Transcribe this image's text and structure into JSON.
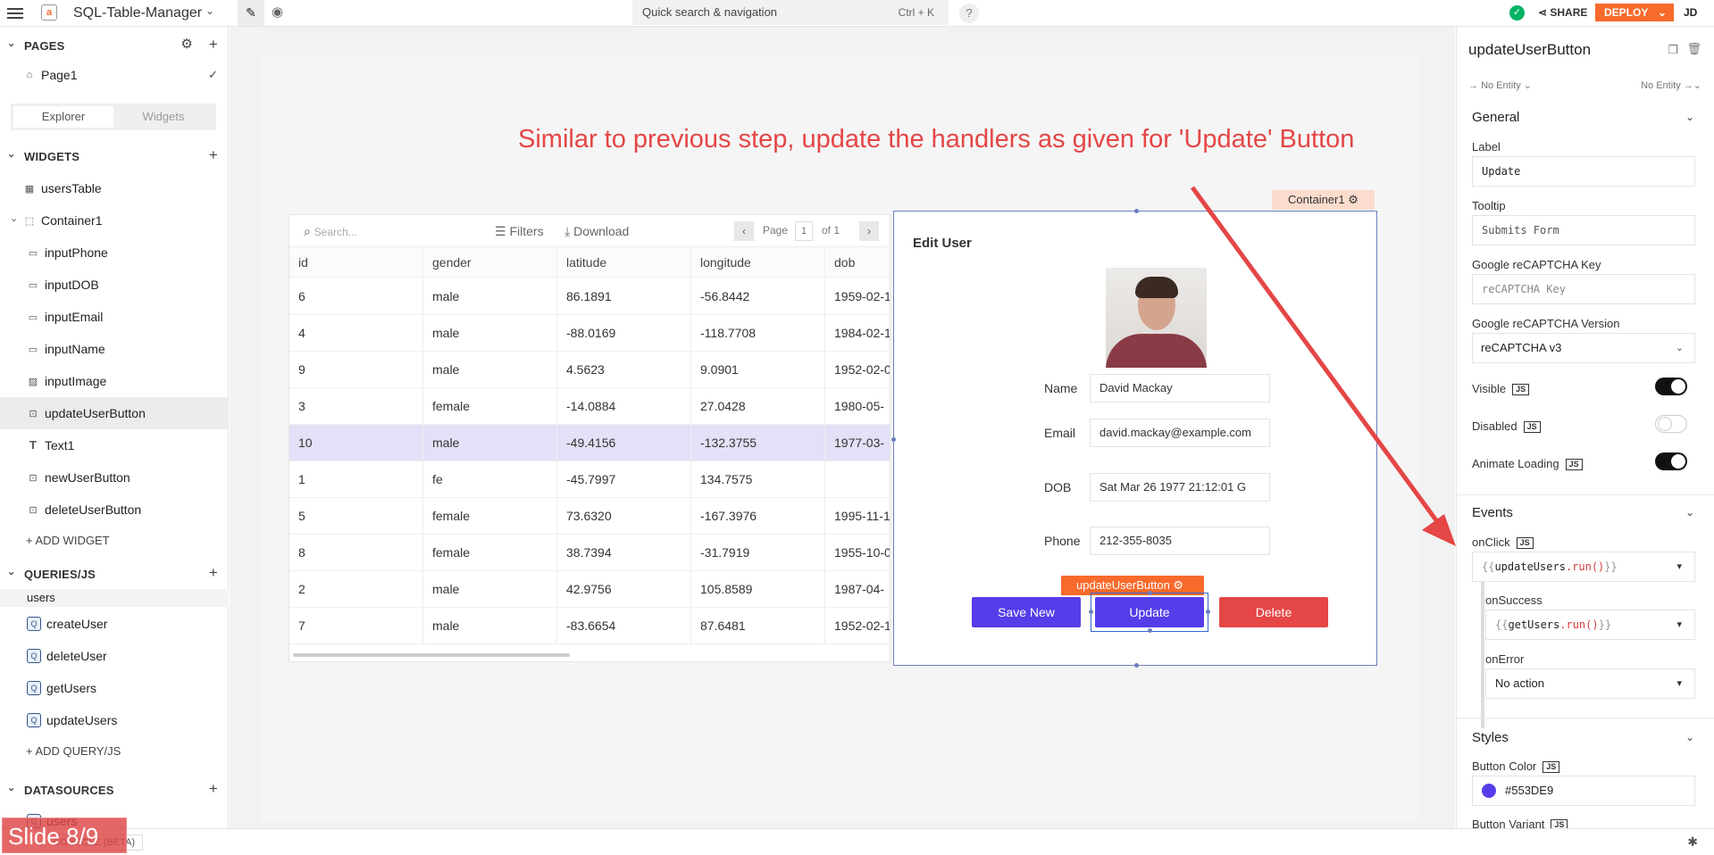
{
  "topbar": {
    "app_title": "SQL-Table-Manager",
    "search_label": "Quick search & navigation",
    "search_shortcut": "Ctrl + K",
    "help": "?",
    "share": "SHARE",
    "deploy": "DEPLOY",
    "user_initials": "JD"
  },
  "sidebar": {
    "pages_title": "PAGES",
    "page1": "Page1",
    "tab_explorer": "Explorer",
    "tab_widgets": "Widgets",
    "widgets_title": "WIDGETS",
    "widgets": [
      "usersTable",
      "Container1",
      "inputPhone",
      "inputDOB",
      "inputEmail",
      "inputName",
      "inputImage",
      "updateUserButton",
      "Text1",
      "newUserButton",
      "deleteUserButton"
    ],
    "add_widget": "ADD WIDGET",
    "queries_title": "QUERIES/JS",
    "users_group": "users",
    "queries": [
      "createUser",
      "deleteUser",
      "getUsers",
      "updateUsers"
    ],
    "add_query": "ADD QUERY/JS",
    "datasources_title": "DATASOURCES",
    "datasource": "users"
  },
  "bottom": {
    "console": "CONSOLE (BETA)",
    "slide": "Slide 8/9"
  },
  "annotation": "Similar to previous step, update the handlers as given for 'Update' Button",
  "table": {
    "search_placeholder": "Search...",
    "filters": "Filters",
    "download": "Download",
    "page_label": "Page",
    "page_num": "1",
    "page_of": "of 1",
    "columns": [
      "id",
      "gender",
      "latitude",
      "longitude",
      "dob"
    ],
    "rows": [
      [
        "6",
        "male",
        "86.1891",
        "-56.8442",
        "1959-02-1"
      ],
      [
        "4",
        "male",
        "-88.0169",
        "-118.7708",
        "1984-02-1"
      ],
      [
        "9",
        "male",
        "4.5623",
        "9.0901",
        "1952-02-0"
      ],
      [
        "3",
        "female",
        "-14.0884",
        "27.0428",
        "1980-05-"
      ],
      [
        "10",
        "male",
        "-49.4156",
        "-132.3755",
        "1977-03-"
      ],
      [
        "1",
        "fe",
        "-45.7997",
        "134.7575",
        ""
      ],
      [
        "5",
        "female",
        "73.6320",
        "-167.3976",
        "1995-11-1"
      ],
      [
        "8",
        "female",
        "38.7394",
        "-31.7919",
        "1955-10-0"
      ],
      [
        "2",
        "male",
        "42.9756",
        "105.8589",
        "1987-04-"
      ],
      [
        "7",
        "male",
        "-83.6654",
        "87.6481",
        "1952-02-1"
      ]
    ]
  },
  "form": {
    "container_tag": "Container1",
    "title": "Edit User",
    "name_label": "Name",
    "name_value": "David Mackay",
    "email_label": "Email",
    "email_value": "david.mackay@example.com",
    "dob_label": "DOB",
    "dob_value": "Sat Mar 26 1977 21:12:01 G",
    "phone_label": "Phone",
    "phone_value": "212-355-8035",
    "selected_tag": "updateUserButton",
    "save_new": "Save New",
    "update": "Update",
    "delete": "Delete"
  },
  "props": {
    "widget_name": "updateUserButton",
    "entity_left": "No Entity",
    "entity_right": "No Entity",
    "general": "General",
    "label_lbl": "Label",
    "label_val": "Update",
    "tooltip_lbl": "Tooltip",
    "tooltip_val": "Submits Form",
    "recaptcha_key_lbl": "Google reCAPTCHA Key",
    "recaptcha_key_ph": "reCAPTCHA Key",
    "recaptcha_ver_lbl": "Google reCAPTCHA Version",
    "recaptcha_ver_val": "reCAPTCHA v3",
    "visible": "Visible",
    "disabled": "Disabled",
    "animate": "Animate Loading",
    "js": "JS",
    "events": "Events",
    "onclick": "onClick",
    "onclick_query": "updateUsers",
    "onclick_fn": ".run()",
    "onsuccess": "onSuccess",
    "onsuccess_query": "getUsers",
    "onsuccess_fn": ".run()",
    "onerror": "onError",
    "onerror_val": "No action",
    "styles": "Styles",
    "button_color_lbl": "Button Color",
    "button_color_val": "#553DE9",
    "button_variant_lbl": "Button Variant",
    "brace_open": "{{",
    "brace_close": "}}"
  },
  "colors": {
    "brand": "#F86A2B",
    "primary_button": "#553DE9",
    "delete_button": "#E54646",
    "annotation": "#E54646"
  },
  "icons": [
    "hamburger-icon",
    "pencil-icon",
    "eye-icon",
    "check-circle-icon",
    "share-icon",
    "gear-icon",
    "plus-icon",
    "home-icon",
    "table-icon",
    "container-icon",
    "input-icon",
    "image-icon",
    "button-icon",
    "text-icon",
    "query-icon",
    "search-icon",
    "filter-icon",
    "download-icon",
    "copy-icon",
    "trash-icon",
    "bug-icon"
  ]
}
